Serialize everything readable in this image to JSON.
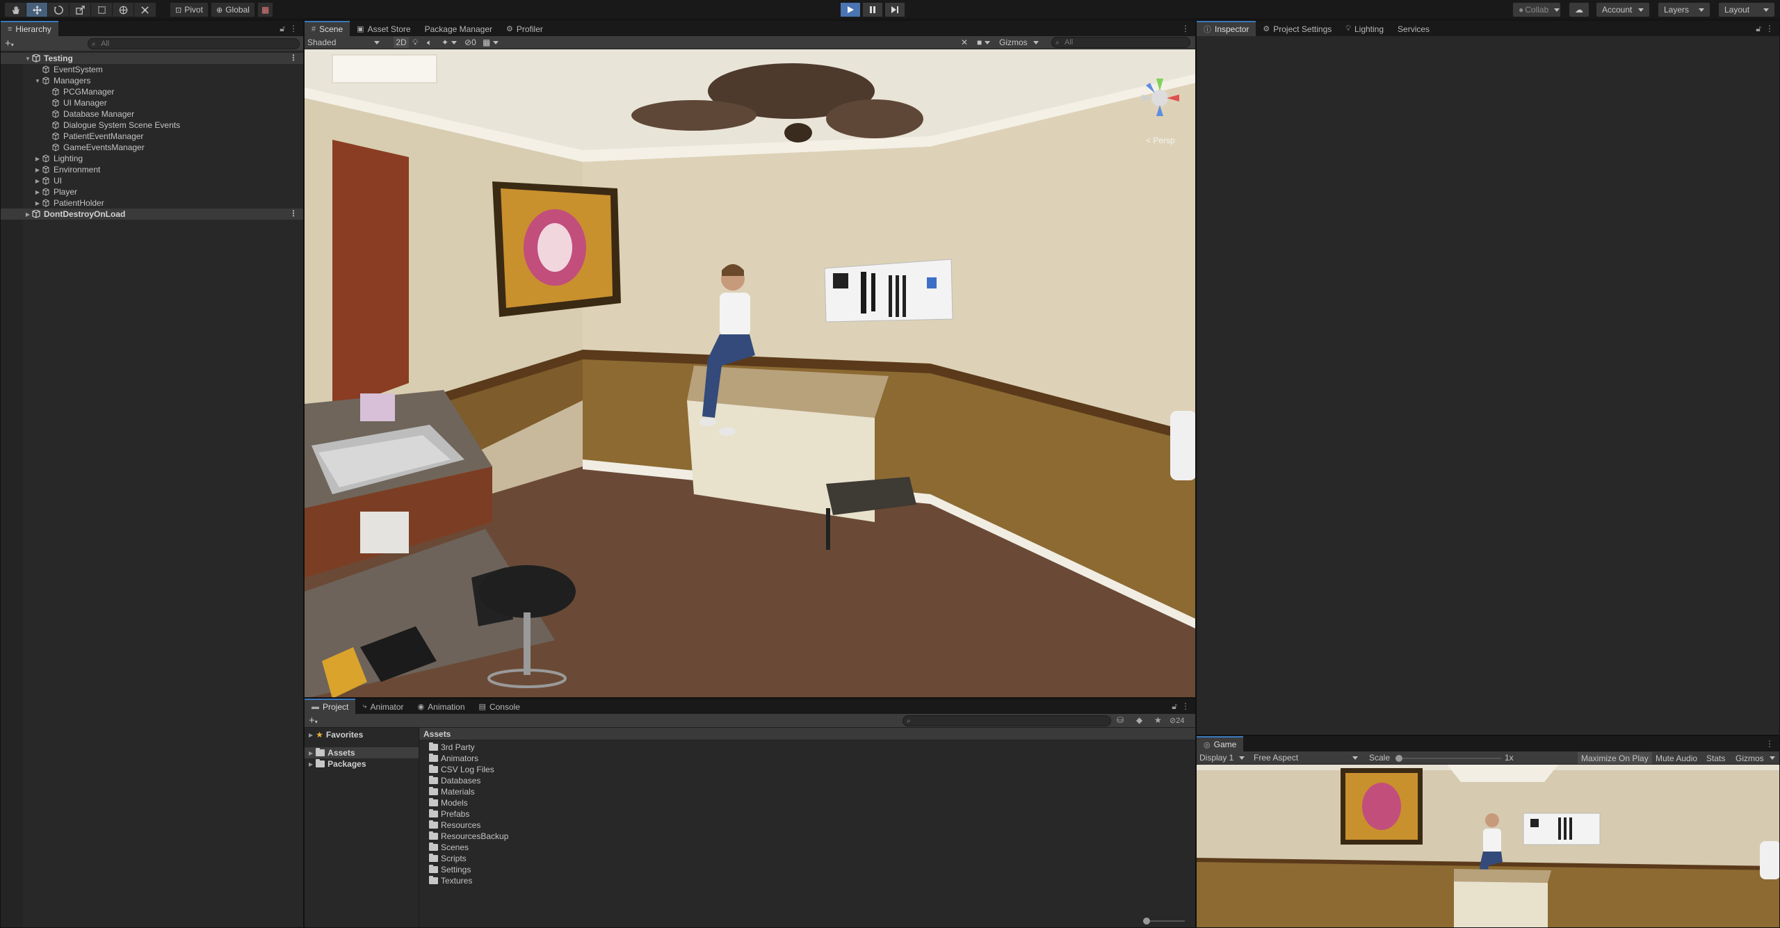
{
  "toolbar": {
    "pivot_label": "Pivot",
    "global_label": "Global",
    "collab_label": "Collab",
    "account_label": "Account",
    "layers_label": "Layers",
    "layout_label": "Layout",
    "tools": [
      "hand-tool-icon",
      "move-tool-icon",
      "rotate-tool-icon",
      "scale-tool-icon",
      "rect-tool-icon",
      "transform-tool-icon",
      "custom-tool-icon"
    ]
  },
  "hierarchy": {
    "tab_label": "Hierarchy",
    "search_placeholder": "All",
    "items": [
      {
        "label": "Testing",
        "depth": 0,
        "scene": true
      },
      {
        "label": "EventSystem",
        "depth": 1
      },
      {
        "label": "Managers",
        "depth": 1,
        "open": true
      },
      {
        "label": "PCGManager",
        "depth": 2
      },
      {
        "label": "UI Manager",
        "depth": 2
      },
      {
        "label": "Database Manager",
        "depth": 2
      },
      {
        "label": "Dialogue System Scene Events",
        "depth": 2
      },
      {
        "label": "PatientEventManager",
        "depth": 2
      },
      {
        "label": "GameEventsManager",
        "depth": 2
      },
      {
        "label": "Lighting",
        "depth": 1,
        "collapsed": true
      },
      {
        "label": "Environment",
        "depth": 1,
        "collapsed": true
      },
      {
        "label": "UI",
        "depth": 1,
        "collapsed": true
      },
      {
        "label": "Player",
        "depth": 1,
        "collapsed": true
      },
      {
        "label": "PatientHolder",
        "depth": 1,
        "collapsed": true
      },
      {
        "label": "DontDestroyOnLoad",
        "depth": 0,
        "scene": true
      }
    ]
  },
  "scene": {
    "tabs": [
      "Scene",
      "Asset Store",
      "Package Manager",
      "Profiler"
    ],
    "shading_mode": "Shaded",
    "mode_2d": "2D",
    "hidden_count": "0",
    "gizmos_label": "Gizmos",
    "search_placeholder": "All",
    "persp_label": "< Persp"
  },
  "inspector": {
    "tabs": [
      "Inspector",
      "Project Settings",
      "Lighting",
      "Services"
    ]
  },
  "project": {
    "tabs": [
      "Project",
      "Animator",
      "Animation",
      "Console"
    ],
    "favorites_label": "Favorites",
    "assets_label": "Assets",
    "packages_label": "Packages",
    "assets_header": "Assets",
    "hidden_packages_count": "24",
    "folders": [
      "3rd Party",
      "Animators",
      "CSV Log Files",
      "Databases",
      "Materials",
      "Models",
      "Prefabs",
      "Resources",
      "ResourcesBackup",
      "Scenes",
      "Scripts",
      "Settings",
      "Textures"
    ]
  },
  "game": {
    "tab_label": "Game",
    "display_label": "Display 1",
    "aspect_label": "Free Aspect",
    "scale_label": "Scale",
    "scale_value": "1x",
    "maximize_label": "Maximize On Play",
    "mute_label": "Mute Audio",
    "stats_label": "Stats",
    "gizmos_label": "Gizmos"
  },
  "colors": {
    "accent_blue": "#3a79bb",
    "play_active": "#4a74b2",
    "panel_bg": "#282828",
    "toolbar_bg": "#191919",
    "wall": "#d9cdb2",
    "wainscot": "#8c6a32",
    "floor": "#6a4a36"
  }
}
